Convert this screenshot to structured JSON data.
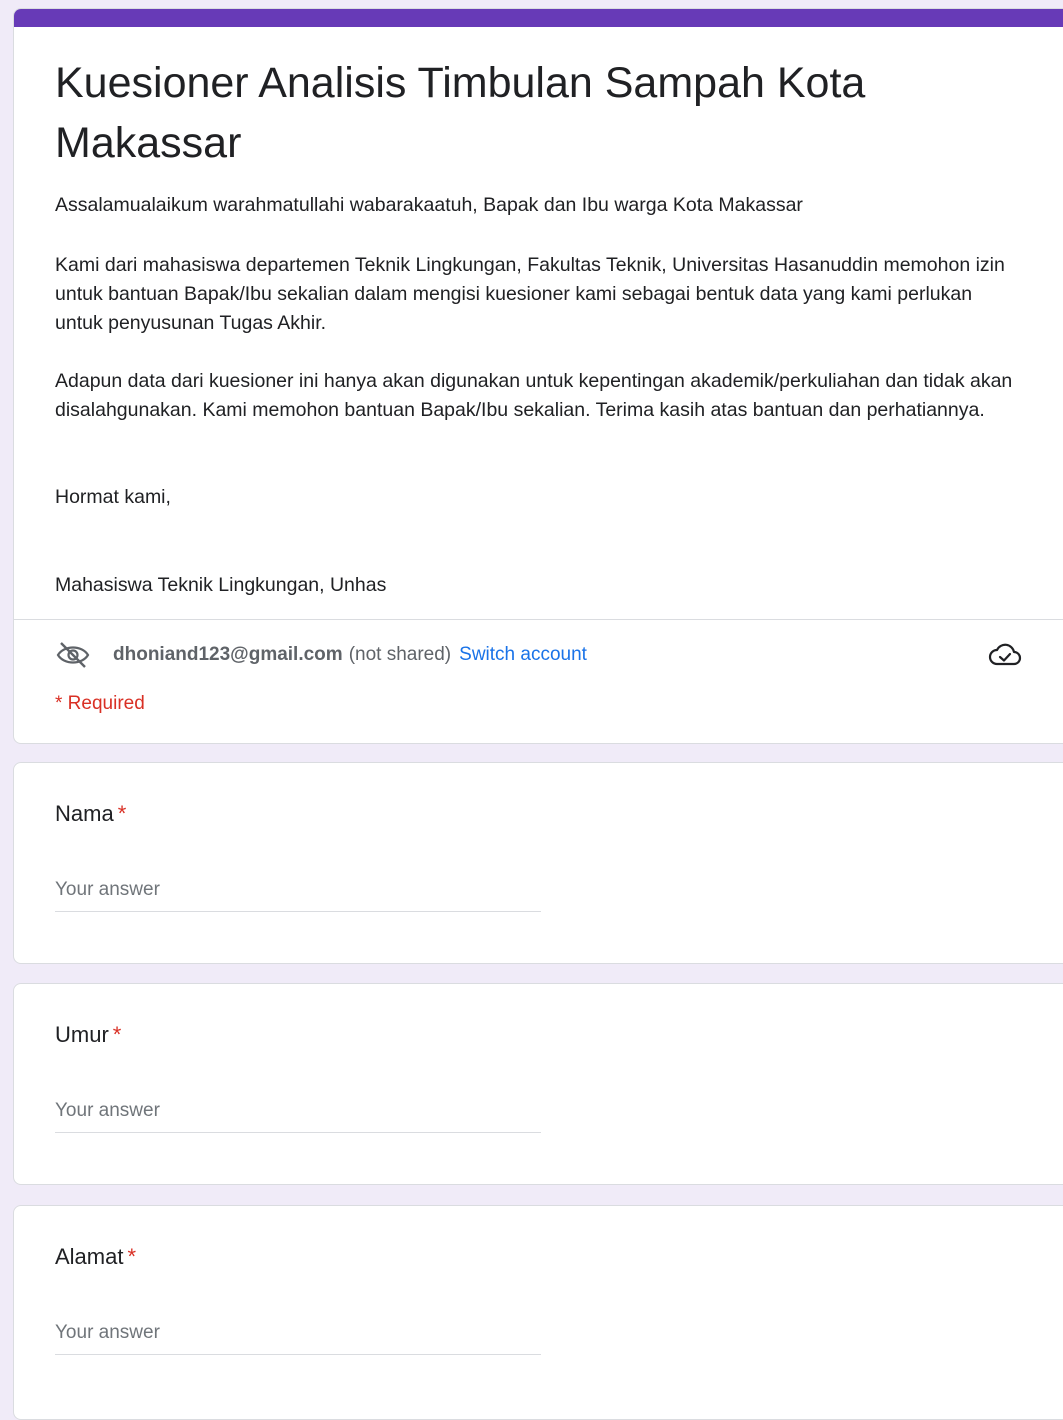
{
  "form": {
    "title": "Kuesioner Analisis Timbulan Sampah Kota Makassar",
    "description": [
      "Assalamualaikum warahmatullahi wabarakaatuh, Bapak dan Ibu warga Kota Makassar",
      "Kami dari mahasiswa departemen Teknik Lingkungan, Fakultas Teknik, Universitas Hasanuddin memohon izin untuk bantuan Bapak/Ibu sekalian dalam mengisi kuesioner kami sebagai bentuk data yang kami perlukan untuk penyusunan Tugas Akhir.",
      "Adapun data dari kuesioner ini hanya akan digunakan untuk kepentingan akademik/perkuliahan dan tidak akan  disalahgunakan. Kami memohon bantuan Bapak/Ibu sekalian. Terima kasih atas bantuan dan perhatiannya.",
      "Hormat kami,",
      "Mahasiswa Teknik Lingkungan, Unhas"
    ]
  },
  "account": {
    "icon": "eye-off-icon",
    "email": "dhoniand123@gmail.com",
    "not_shared": "(not shared)",
    "switch_label": "Switch account",
    "cloud_icon": "cloud-saved-icon"
  },
  "required_note": "* Required",
  "questions": [
    {
      "label": "Nama",
      "required_mark": "*",
      "placeholder": "Your answer"
    },
    {
      "label": "Umur",
      "required_mark": "*",
      "placeholder": "Your answer"
    },
    {
      "label": "Alamat",
      "required_mark": "*",
      "placeholder": "Your answer"
    }
  ],
  "colors": {
    "accent": "#673ab7",
    "background": "#f0ebf8",
    "required": "#d93025",
    "link": "#1a73e8"
  }
}
